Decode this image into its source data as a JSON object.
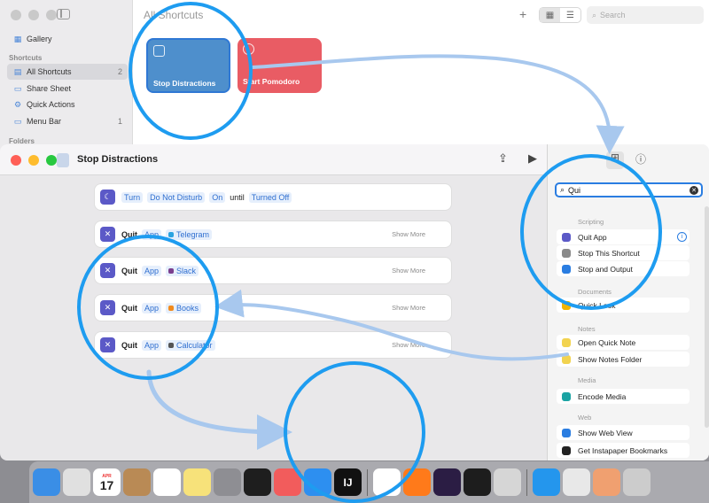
{
  "bg_window": {
    "title": "All Shortcuts",
    "sidebar": {
      "items": [
        {
          "label": "Gallery",
          "icon": "gallery-icon",
          "count": ""
        },
        {
          "label": "All Shortcuts",
          "icon": "grid-icon",
          "count": "2"
        },
        {
          "label": "Share Sheet",
          "icon": "share-sheet-icon",
          "count": ""
        },
        {
          "label": "Quick Actions",
          "icon": "gear-icon",
          "count": ""
        },
        {
          "label": "Menu Bar",
          "icon": "menu-bar-icon",
          "count": "1"
        }
      ],
      "section_shortcuts": "Shortcuts",
      "section_folders": "Folders"
    },
    "search_placeholder": "Search",
    "tiles": [
      {
        "label": "Stop Distractions",
        "color": "#4e8fcc"
      },
      {
        "label": "Start Pomodoro",
        "color": "#e95c64"
      }
    ]
  },
  "editor": {
    "title": "Stop Distractions",
    "actions": [
      {
        "tokens": [
          {
            "t": "tok",
            "v": "Turn"
          },
          {
            "t": "tok",
            "v": "Do Not Disturb"
          },
          {
            "t": "tok",
            "v": "On"
          },
          {
            "t": "plain",
            "v": "until"
          },
          {
            "t": "tok",
            "v": "Turned Off"
          }
        ],
        "icon": "moon-icon",
        "show_more": ""
      },
      {
        "tokens": [
          {
            "t": "word",
            "v": "Quit"
          },
          {
            "t": "tok",
            "v": "App"
          },
          {
            "t": "app",
            "v": "Telegram",
            "color": "#2aa3e0"
          }
        ],
        "icon": "quit-icon",
        "show_more": "Show More"
      },
      {
        "tokens": [
          {
            "t": "word",
            "v": "Quit"
          },
          {
            "t": "tok",
            "v": "App"
          },
          {
            "t": "app",
            "v": "Slack",
            "color": "#7a3f8e"
          }
        ],
        "icon": "quit-icon",
        "show_more": "Show More"
      },
      {
        "tokens": [
          {
            "t": "word",
            "v": "Quit"
          },
          {
            "t": "tok",
            "v": "App"
          },
          {
            "t": "app",
            "v": "Books",
            "color": "#f28a1c"
          }
        ],
        "icon": "quit-icon",
        "show_more": "Show More"
      },
      {
        "tokens": [
          {
            "t": "word",
            "v": "Quit"
          },
          {
            "t": "tok",
            "v": "App"
          },
          {
            "t": "app",
            "v": "Calculator",
            "color": "#555555"
          }
        ],
        "icon": "quit-icon",
        "show_more": "Show More"
      }
    ]
  },
  "panel": {
    "search_value": "Qui",
    "sections": [
      {
        "name": "Scripting",
        "items": [
          {
            "label": "Quit App",
            "color": "#5b59c7",
            "info": true
          },
          {
            "label": "Stop This Shortcut",
            "color": "#8a8a8a",
            "info": false
          },
          {
            "label": "Stop and Output",
            "color": "#2a7de1",
            "info": false
          }
        ]
      },
      {
        "name": "Documents",
        "items": [
          {
            "label": "Quick Look",
            "color": "#f0b400",
            "info": false
          }
        ]
      },
      {
        "name": "Notes",
        "items": [
          {
            "label": "Open Quick Note",
            "color": "#f2d34f",
            "info": false
          },
          {
            "label": "Show Notes Folder",
            "color": "#f2d34f",
            "info": false
          }
        ]
      },
      {
        "name": "Media",
        "items": [
          {
            "label": "Encode Media",
            "color": "#1aa3a3",
            "info": false
          }
        ]
      },
      {
        "name": "Web",
        "items": [
          {
            "label": "Show Web View",
            "color": "#2a7de1",
            "info": false
          },
          {
            "label": "Get Instapaper Bookmarks",
            "color": "#222222",
            "info": false
          }
        ]
      }
    ]
  },
  "dock": {
    "calendar_month": "APR",
    "calendar_day": "17",
    "intellij_label": "IJ",
    "apps": [
      {
        "name": "finder",
        "color": "#3a8ee6"
      },
      {
        "name": "launchpad",
        "color": "#e0e0e0"
      },
      {
        "name": "calendar",
        "color": "#ffffff"
      },
      {
        "name": "contacts",
        "color": "#b98a55"
      },
      {
        "name": "reminders",
        "color": "#ffffff"
      },
      {
        "name": "notes",
        "color": "#f7e27a"
      },
      {
        "name": "system-settings",
        "color": "#8e8e93"
      },
      {
        "name": "terminal",
        "color": "#1e1e1e"
      },
      {
        "name": "timer",
        "color": "#f25c5c"
      },
      {
        "name": "raise-hand",
        "color": "#2d8ff0"
      },
      {
        "name": "intellij",
        "color": "#111111"
      },
      {
        "name": "chrome",
        "color": "#ffffff"
      },
      {
        "name": "firefox",
        "color": "#ff7a1a"
      },
      {
        "name": "obsidian",
        "color": "#2b1d44"
      },
      {
        "name": "activity-monitor",
        "color": "#1d1d1d"
      },
      {
        "name": "preview",
        "color": "#d6d6d6"
      },
      {
        "name": "docker",
        "color": "#2496ed"
      },
      {
        "name": "git",
        "color": "#e8e8e8"
      },
      {
        "name": "rocket",
        "color": "#f0a070"
      },
      {
        "name": "misc",
        "color": "#cccccc"
      }
    ]
  }
}
